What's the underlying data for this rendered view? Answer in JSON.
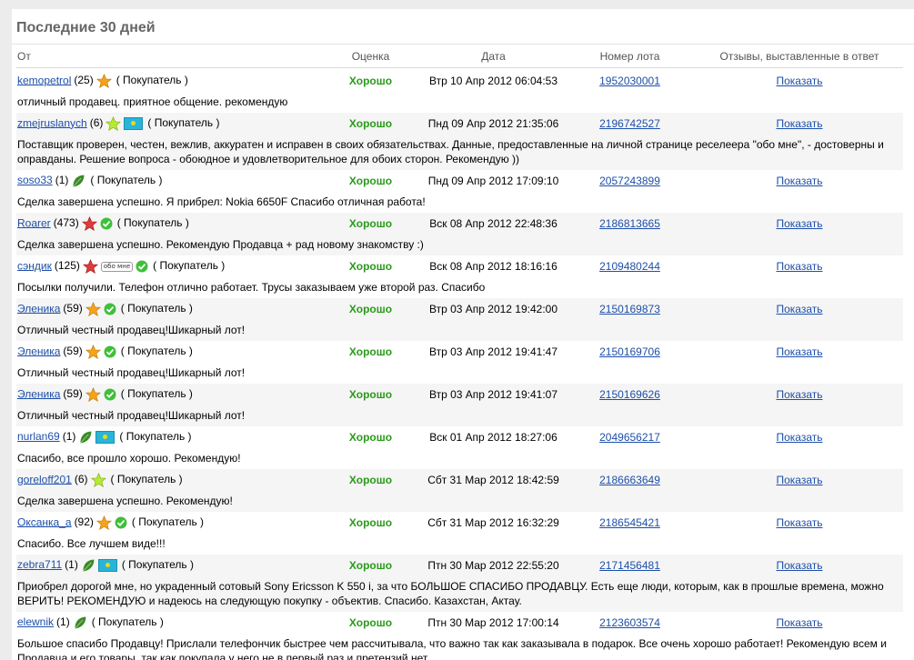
{
  "heading": "Последние 30 дней",
  "columns": {
    "from": "От",
    "rating": "Оценка",
    "date": "Дата",
    "lot": "Номер лота",
    "replies": "Отзывы, выставленные в ответ"
  },
  "role_label": "( Покупатель )",
  "colors": {
    "link": "#1e4fa8",
    "good": "#2a9a1a",
    "star_orange": "#f5a31c",
    "star_red": "#e03a3a",
    "star_lime": "#a8e22c",
    "leaf": "#3a8a2a",
    "check": "#3fbf3a"
  },
  "rows": [
    {
      "user": "kemopetrol",
      "count": "(25)",
      "icons": [
        "star-orange"
      ],
      "rating": "Хорошо",
      "date": "Втр 10 Апр 2012 06:04:53",
      "lot": "1952030001",
      "replies": "Показать",
      "comment": "отличный продавец. приятное общение. рекомендую"
    },
    {
      "user": "zmejruslanych",
      "count": "(6)",
      "icons": [
        "star-lime",
        "flag-kz"
      ],
      "rating": "Хорошо",
      "date": "Пнд 09 Апр 2012 21:35:06",
      "lot": "2196742527",
      "replies": "Показать",
      "comment": "Поставщик проверен, честен, вежлив, аккуратен и исправен в своих обязательствах. Данные, предоставленные на личной странице реселеера \"обо мне\", - достоверны и оправданы. Решение вопроса - обоюдное и удовлетворительное для обоих сторон. Рекомендую ))"
    },
    {
      "user": "soso33",
      "count": "(1)",
      "icons": [
        "leaf"
      ],
      "rating": "Хорошо",
      "date": "Пнд 09 Апр 2012 17:09:10",
      "lot": "2057243899",
      "replies": "Показать",
      "comment": "Сделка завершена успешно. Я прибрел: Nokia 6650F Спасибо отличная работа!"
    },
    {
      "user": "Roarer",
      "count": "(473)",
      "icons": [
        "star-red",
        "check"
      ],
      "rating": "Хорошо",
      "date": "Вск 08 Апр 2012 22:48:36",
      "lot": "2186813665",
      "replies": "Показать",
      "comment": "Сделка завершена успешно. Рекомендую Продавца + рад новому знакомству :)"
    },
    {
      "user": "сэндик",
      "count": "(125)",
      "icons": [
        "star-red",
        "about",
        "check"
      ],
      "about": "обо мне",
      "rating": "Хорошо",
      "date": "Вск 08 Апр 2012 18:16:16",
      "lot": "2109480244",
      "replies": "Показать",
      "comment": "Посылки получили. Телефон отлично работает. Трусы заказываем уже второй раз. Спасибо"
    },
    {
      "user": "Эленика",
      "count": "(59)",
      "icons": [
        "star-orange",
        "check"
      ],
      "rating": "Хорошо",
      "date": "Втр 03 Апр 2012 19:42:00",
      "lot": "2150169873",
      "replies": "Показать",
      "comment": "Отличный честный продавец!Шикарный лот!"
    },
    {
      "user": "Эленика",
      "count": "(59)",
      "icons": [
        "star-orange",
        "check"
      ],
      "rating": "Хорошо",
      "date": "Втр 03 Апр 2012 19:41:47",
      "lot": "2150169706",
      "replies": "Показать",
      "comment": "Отличный честный продавец!Шикарный лот!"
    },
    {
      "user": "Эленика",
      "count": "(59)",
      "icons": [
        "star-orange",
        "check"
      ],
      "rating": "Хорошо",
      "date": "Втр 03 Апр 2012 19:41:07",
      "lot": "2150169626",
      "replies": "Показать",
      "comment": "Отличный честный продавец!Шикарный лот!"
    },
    {
      "user": "nurlan69",
      "count": "(1)",
      "icons": [
        "leaf",
        "flag-kz"
      ],
      "rating": "Хорошо",
      "date": "Вск 01 Апр 2012 18:27:06",
      "lot": "2049656217",
      "replies": "Показать",
      "comment": "Спасибо, все прошло хорошо. Рекомендую!"
    },
    {
      "user": "goreloff201",
      "count": "(6)",
      "icons": [
        "star-lime"
      ],
      "rating": "Хорошо",
      "date": "Сбт 31 Мар 2012 18:42:59",
      "lot": "2186663649",
      "replies": "Показать",
      "comment": "Сделка завершена успешно. Рекомендую!"
    },
    {
      "user": "Оксанка_а",
      "count": "(92)",
      "icons": [
        "star-orange",
        "check"
      ],
      "rating": "Хорошо",
      "date": "Сбт 31 Мар 2012 16:32:29",
      "lot": "2186545421",
      "replies": "Показать",
      "comment": "Спасибо. Все лучшем виде!!!"
    },
    {
      "user": "zebra711",
      "count": "(1)",
      "icons": [
        "leaf",
        "flag-kz"
      ],
      "rating": "Хорошо",
      "date": "Птн 30 Мар 2012 22:55:20",
      "lot": "2171456481",
      "replies": "Показать",
      "comment": "Приобрел дорогой мне, но украденный сотовый Sony Ericsson K 550 i, за что БОЛЬШОЕ СПАСИБО ПРОДАВЦУ. Есть еще люди, которым, как в прошлые времена, можно ВЕРИТЬ! РЕКОМЕНДУЮ и надеюсь на следующую покупку - объектив. Спасибо. Казахстан, Актау."
    },
    {
      "user": "elewnik",
      "count": "(1)",
      "icons": [
        "leaf"
      ],
      "rating": "Хорошо",
      "date": "Птн 30 Мар 2012 17:00:14",
      "lot": "2123603574",
      "replies": "Показать",
      "comment": "Большое спасибо Продавцу! Прислали телефончик быстрее чем рассчитывала, что важно так как заказывала в подарок. Все очень хорошо работает! Рекомендую всем и Продавца и его товары, так как покупала у него не в первый раз и претензий нет."
    }
  ]
}
